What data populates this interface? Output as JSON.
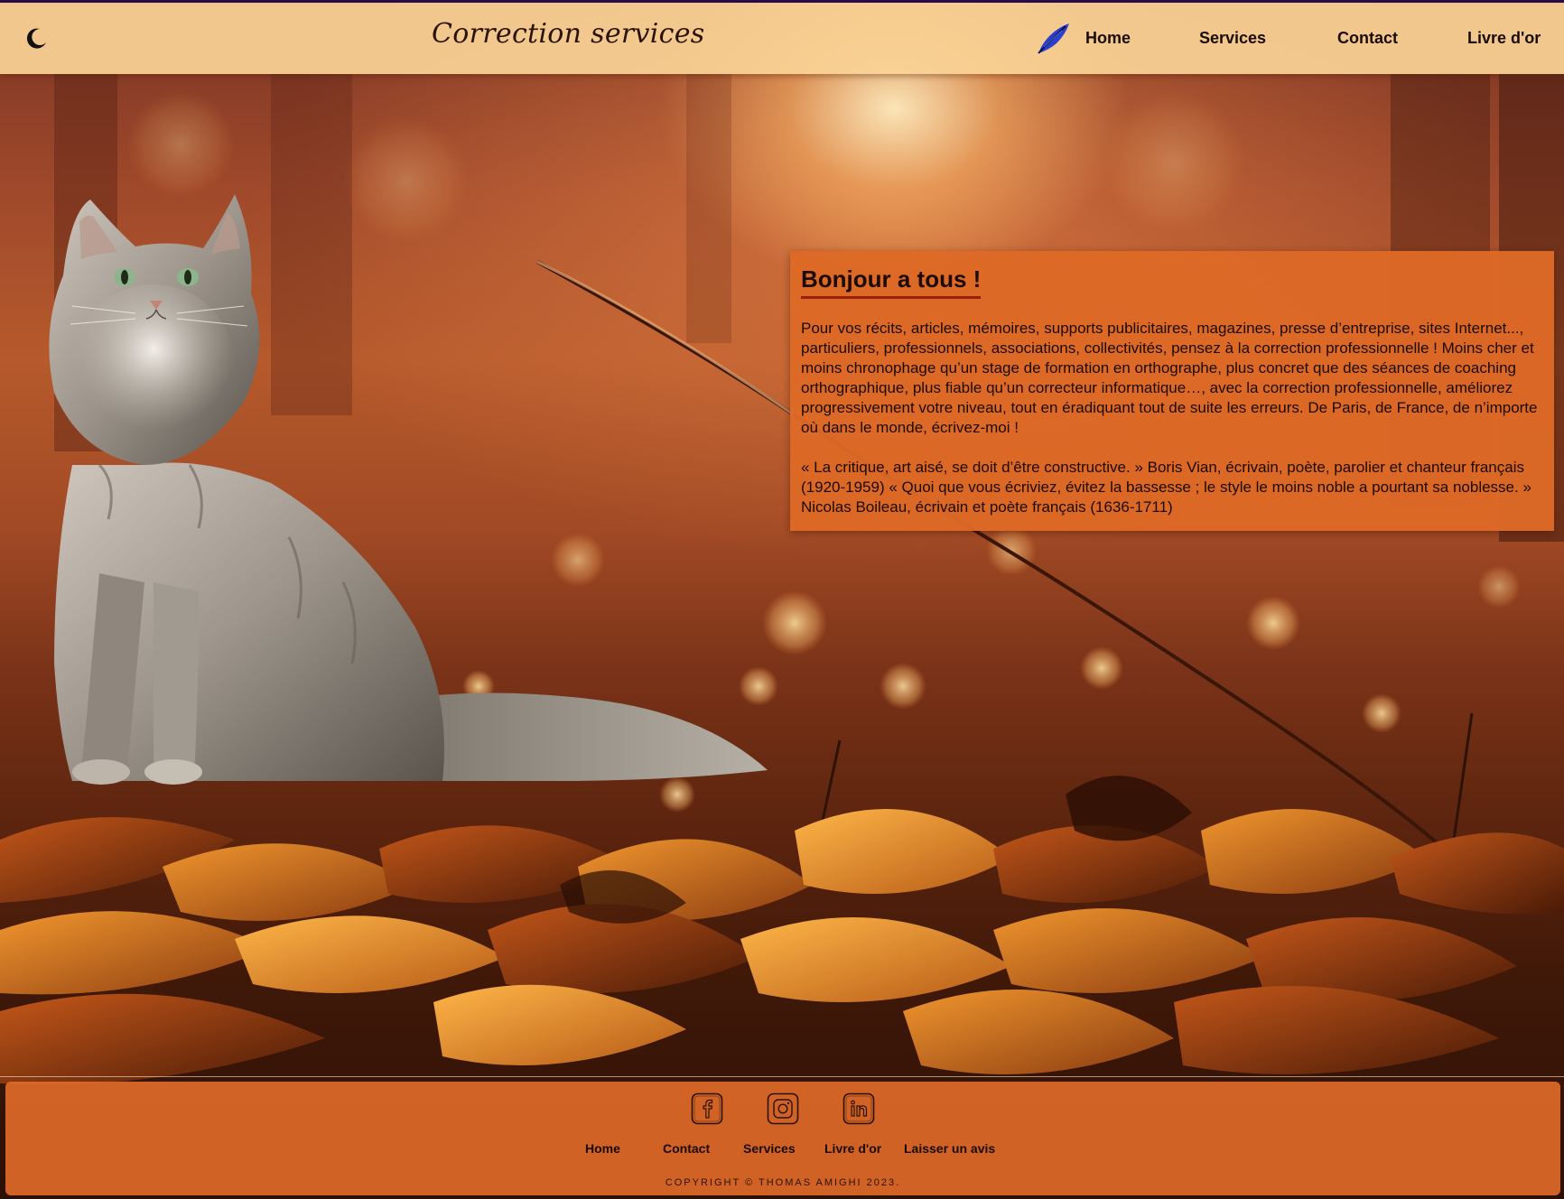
{
  "header": {
    "site_title": "Correction services",
    "theme_toggle_icon": "moon-icon",
    "logo_icon": "feather-icon",
    "nav": {
      "home": "Home",
      "services": "Services",
      "contact": "Contact",
      "livre_dor": "Livre d'or"
    }
  },
  "hero": {
    "image": "cat-photo",
    "background": "autumn-leaves-forest-photo"
  },
  "welcome": {
    "title": "Bonjour a tous !",
    "paragraph": "Pour vos récits, articles, mémoires, supports publicitaires, magazines, presse d’entreprise, sites Internet..., particuliers, professionnels, associations, collectivités, pensez à la correction professionnelle ! Moins cher et moins chronophage qu’un stage de formation en orthographe, plus concret que des séances de coaching orthographique, plus fiable qu’un correcteur informatique…, avec la correction professionnelle, améliorez progressivement votre niveau, tout en éradiquant tout de suite les erreurs. De Paris, de France, de n’importe où dans le monde, écrivez-moi !",
    "quotes": "« La critique, art aisé, se doit d’être constructive. » Boris Vian, écrivain, poète, parolier et chanteur français (1920-1959) « Quoi que vous écriviez, évitez la bassesse ; le style le moins noble a pourtant sa noblesse. » Nicolas Boileau, écrivain et poète français (1636-1711)"
  },
  "footer": {
    "social": [
      "facebook-icon",
      "instagram-icon",
      "linkedin-icon"
    ],
    "links": {
      "home": "Home",
      "contact": "Contact",
      "services": "Services",
      "livre_dor": "Livre d'or",
      "avis": "Laisser un avis"
    },
    "copyright": "COPYRIGHT © THOMAS AMIGHI 2023."
  },
  "colors": {
    "header_bg": "#fad296",
    "card_bg": "#de6926",
    "footer_bg": "#e26c2a",
    "title_underline": "#9c1f0c",
    "text": "#1a0a02"
  }
}
